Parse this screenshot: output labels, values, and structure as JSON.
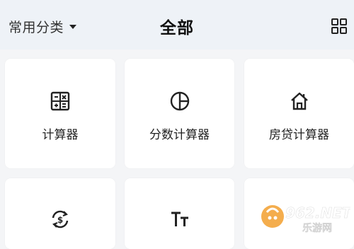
{
  "header": {
    "category_label": "常用分类",
    "title": "全部",
    "icons": {
      "dropdown": "chevron-down-icon",
      "grid": "grid-view-icon"
    }
  },
  "tiles": [
    {
      "label": "计算器",
      "icon": "calculator-icon"
    },
    {
      "label": "分数计算器",
      "icon": "pie-chart-icon"
    },
    {
      "label": "房贷计算器",
      "icon": "house-icon"
    },
    {
      "label": "",
      "icon": "currency-exchange-icon"
    },
    {
      "label": "",
      "icon": "text-size-icon"
    },
    {
      "label": "",
      "icon": ""
    }
  ],
  "watermark": {
    "brand": "962.NET",
    "sub": "乐游网"
  }
}
